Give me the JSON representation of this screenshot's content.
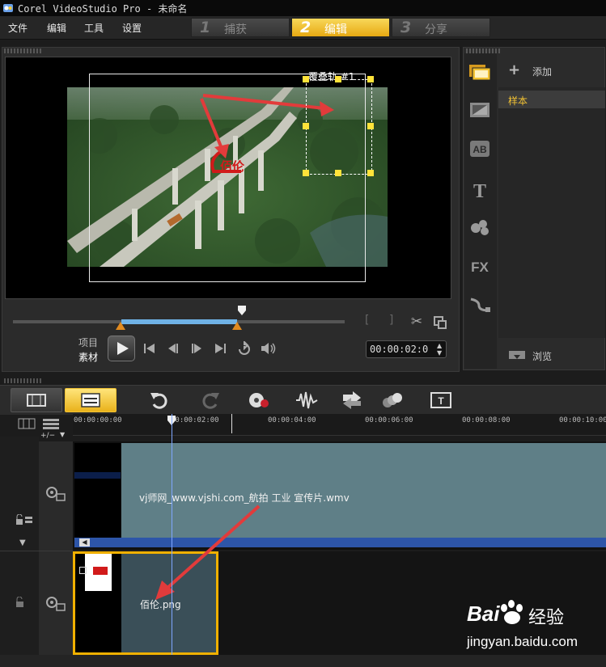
{
  "window": {
    "title": "Corel VideoStudio Pro - 未命名"
  },
  "menu": {
    "items": [
      "文件",
      "编辑",
      "工具",
      "设置"
    ]
  },
  "steps": [
    {
      "num": "1",
      "label": "捕获"
    },
    {
      "num": "2",
      "label": "编辑"
    },
    {
      "num": "3",
      "label": "分享"
    }
  ],
  "preview": {
    "overlay_label": "覆叠轨 #1",
    "logo_text": "佰伦",
    "mode_project": "项目",
    "mode_clip": "素材",
    "timecode": "00:00:02:0",
    "bracket_label": "[   ]"
  },
  "library": {
    "add_label": "添加",
    "folder_sample": "样本",
    "browse_label": "浏览"
  },
  "timeline": {
    "ruler": [
      "00:00:00:00",
      "00:00:02:00",
      "00:00:04:00",
      "00:00:06:00",
      "00:00:08:00",
      "00:00:10:00"
    ],
    "zoom_label": "+/−",
    "video_clip": "vj师网_www.vjshi.com_航拍 工业 宣传片.wmv",
    "overlay_clip": "佰伦.png"
  },
  "watermark": {
    "brand": "Bai",
    "brand_suffix": "经验",
    "url": "jingyan.baidu.com"
  },
  "colors": {
    "accent": "#f2c233",
    "annotation": "#e23b3b",
    "clip_video": "#5f7f87",
    "clip_overlay": "#3a4f58",
    "audio_bar": "#2d55a8",
    "selection": "#f0b000"
  }
}
